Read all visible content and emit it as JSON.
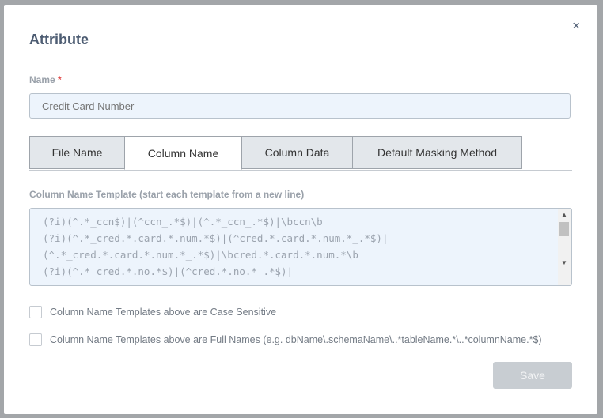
{
  "modal": {
    "title": "Attribute",
    "close_icon": "×",
    "name_label": "Name",
    "required_mark": "*",
    "name_placeholder": "Credit Card Number",
    "tabs": [
      {
        "label": "File Name",
        "active": false
      },
      {
        "label": "Column Name",
        "active": true
      },
      {
        "label": "Column Data",
        "active": false
      },
      {
        "label": "Default Masking Method",
        "active": false
      }
    ],
    "template_label": "Column Name Template (start each template from a new line)",
    "template_value": "(?i)(^.*_ccn$)|(^ccn_.*$)|(^.*_ccn_.*$)|\\bccn\\b\n(?i)(^.*_cred.*.card.*.num.*$)|(^cred.*.card.*.num.*_.*$)|\n(^.*_cred.*.card.*.num.*_.*$)|\\bcred.*.card.*.num.*\\b\n(?i)(^.*_cred.*.no.*$)|(^cred.*.no.*_.*$)|",
    "case_sensitive_label": "Column Name Templates above are Case Sensitive",
    "case_sensitive_checked": false,
    "full_names_label": "Column Name Templates above are Full Names (e.g. dbName\\.schemaName\\..*tableName.*\\..*columnName.*$)",
    "full_names_checked": false,
    "save_label": "Save"
  }
}
